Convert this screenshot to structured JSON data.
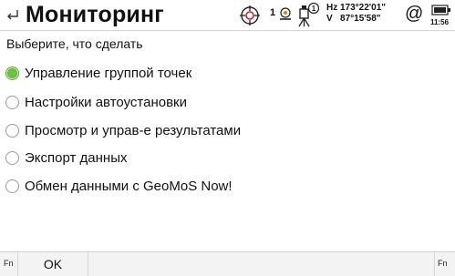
{
  "titlebar": {
    "title": "Мониторинг",
    "back_icon": "back-arrow-icon"
  },
  "statusbar": {
    "prism_constant": "1",
    "hz": "Hz 173°22'01\"",
    "v": "V   87°15'58\"",
    "at_symbol": "@",
    "time": "11:56",
    "accent_color": "#cc2020"
  },
  "prompt": "Выберите, что сделать",
  "options": [
    {
      "label": "Управление группой точек",
      "selected": true
    },
    {
      "label": "Настройки автоустановки",
      "selected": false
    },
    {
      "label": "Просмотр и управ-е результатами",
      "selected": false
    },
    {
      "label": "Экспорт данных",
      "selected": false
    },
    {
      "label": "Обмен данными с GeoMoS Now!",
      "selected": false
    }
  ],
  "bottombar": {
    "fn_left": "Fn",
    "ok_label": "OK",
    "fn_right": "Fn"
  }
}
